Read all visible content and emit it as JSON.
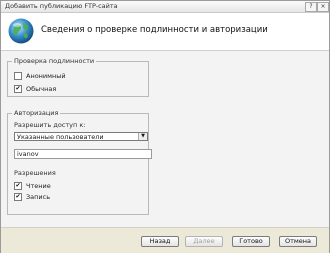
{
  "window": {
    "title": "Добавить публикацию FTP-сайта",
    "help_glyph": "?",
    "close_glyph": "×"
  },
  "header": {
    "title": "Сведения о проверке подлинности и авторизации",
    "icon": "globe-icon"
  },
  "authentication": {
    "group_title": "Проверка подлинности",
    "anonymous": {
      "label": "Анонимный",
      "checked": false
    },
    "basic": {
      "label": "Обычная",
      "checked": true
    }
  },
  "authorization": {
    "group_title": "Авторизация",
    "allow_access_label": "Разрешить доступ к:",
    "allow_access_value": "Указанные пользователи",
    "user_value": "ivanov",
    "permissions_label": "Разрешения",
    "read": {
      "label": "Чтение",
      "checked": true
    },
    "write": {
      "label": "Запись",
      "checked": true
    }
  },
  "footer": {
    "back": "Назад",
    "next": "Далее",
    "finish": "Готово",
    "cancel": "Отмена"
  },
  "check_glyph": "✔"
}
